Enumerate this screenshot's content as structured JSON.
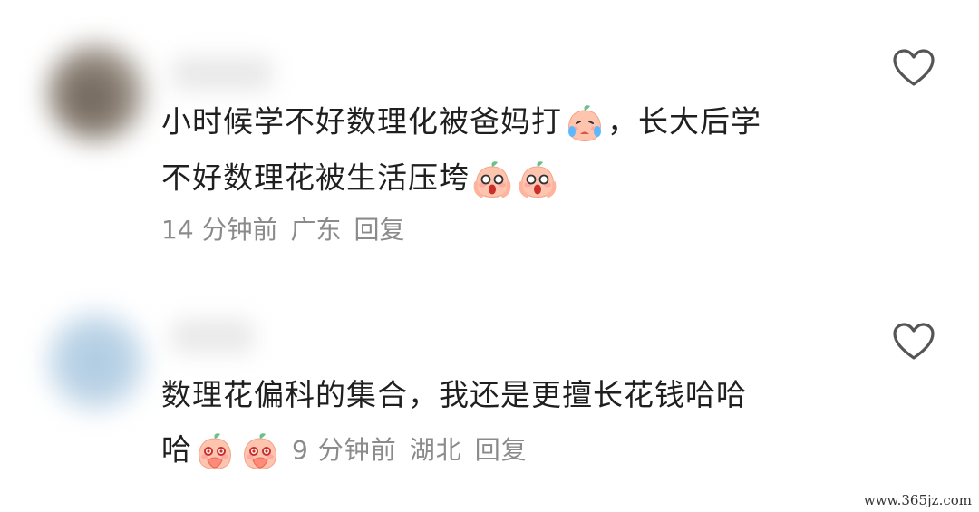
{
  "comments": [
    {
      "line1": "小时候学不好数理化被爸妈打",
      "line1_after": "，长大后学",
      "line2": "不好数理花被生活压垮",
      "time": "14 分钟前",
      "location": "广东",
      "reply": "回复",
      "emojis": [
        "crying-peach-emoji",
        "screaming-peach-emoji",
        "screaming-peach-emoji"
      ]
    },
    {
      "line1": "数理花偏科的集合，我还是更擅长花钱哈哈",
      "line2": "哈",
      "time": "9 分钟前",
      "location": "湖北",
      "reply": "回复",
      "emojis": [
        "laughing-peach-emoji",
        "laughing-peach-emoji"
      ]
    }
  ],
  "icons": {
    "like": "heart-outline-icon"
  },
  "watermark": "www.365jz.com",
  "colors": {
    "text": "#1f1f1f",
    "meta": "#8b8b8b",
    "heart": "#555555"
  }
}
